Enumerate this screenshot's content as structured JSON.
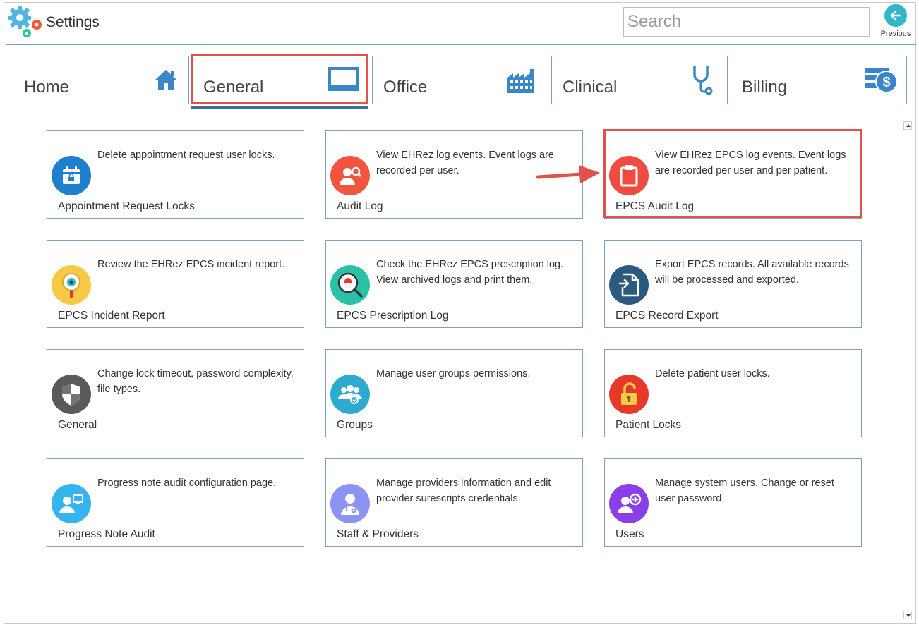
{
  "app": {
    "title": "Settings"
  },
  "search": {
    "placeholder": "Search",
    "value": ""
  },
  "previous": {
    "label": "Previous"
  },
  "tabs": [
    {
      "label": "Home",
      "icon": "home-icon"
    },
    {
      "label": "General",
      "icon": "monitor-icon",
      "active": true
    },
    {
      "label": "Office",
      "icon": "building-icon"
    },
    {
      "label": "Clinical",
      "icon": "stethoscope-icon"
    },
    {
      "label": "Billing",
      "icon": "billing-icon"
    }
  ],
  "cards": [
    {
      "title": "Appointment Request Locks",
      "description": "Delete appointment request user locks.",
      "icon": "calendar-lock-icon",
      "color": "#1f7fcf"
    },
    {
      "title": "Audit Log",
      "description": "View EHRez log events. Event logs are recorded per user.",
      "icon": "user-search-icon",
      "color": "#f2553f"
    },
    {
      "title": "EPCS Audit Log",
      "description": "View EHRez EPCS log events. Event logs are recorded per user and per patient.",
      "icon": "clipboard-icon",
      "color": "#f04b41"
    },
    {
      "title": "EPCS Incident Report",
      "description": "Review the EHRez EPCS incident report.",
      "icon": "magnifier-eye-icon",
      "color": "#f8c945"
    },
    {
      "title": "EPCS Prescription Log",
      "description": "Check the EHRez EPCS prescription log. View archived logs and print them.",
      "icon": "pill-search-icon",
      "color": "#2bc1a6"
    },
    {
      "title": "EPCS Record Export",
      "description": "Export EPCS records. All available records will be processed and exported.",
      "icon": "file-export-icon",
      "color": "#2b5a80"
    },
    {
      "title": "General",
      "description": "Change lock timeout, password complexity, file types.",
      "icon": "shield-icon",
      "color": "#5a5a5a"
    },
    {
      "title": "Groups",
      "description": "Manage user groups permissions.",
      "icon": "group-icon",
      "color": "#2eaad0"
    },
    {
      "title": "Patient Locks",
      "description": "Delete patient user locks.",
      "icon": "padlock-icon",
      "color": "#e8372b"
    },
    {
      "title": "Progress Note Audit",
      "description": "Progress note audit configuration page.",
      "icon": "user-monitor-icon",
      "color": "#35b4f0"
    },
    {
      "title": "Staff & Providers",
      "description": "Manage providers information and edit provider surescripts credentials.",
      "icon": "doctor-icon",
      "color": "#8b93f3"
    },
    {
      "title": "Users",
      "description": "Manage system users. Change or reset user password",
      "icon": "user-add-icon",
      "color": "#8b3fe8"
    }
  ]
}
